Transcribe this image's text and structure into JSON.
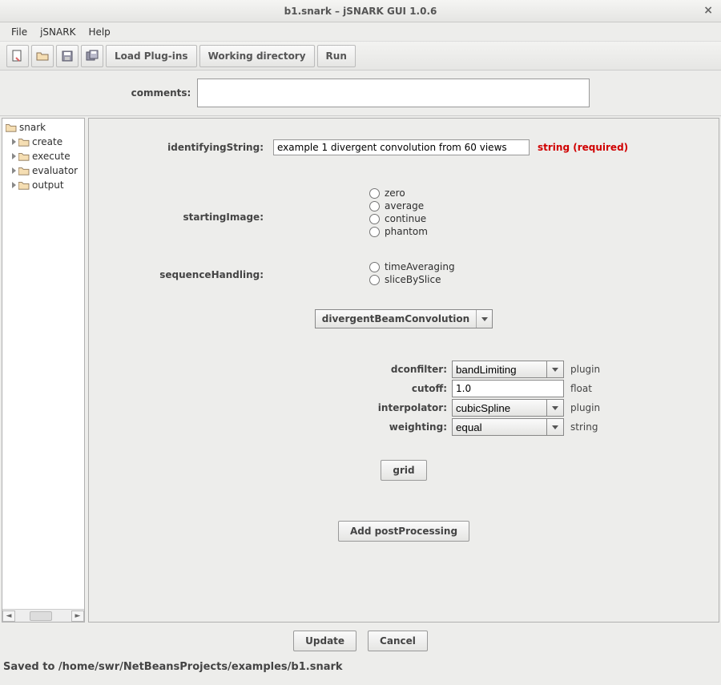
{
  "window": {
    "title": "b1.snark – jSNARK GUI 1.0.6"
  },
  "menubar": {
    "file": "File",
    "jsnark": "jSNARK",
    "help": "Help"
  },
  "toolbar": {
    "load_plugins": "Load Plug-ins",
    "working_directory": "Working directory",
    "run": "Run"
  },
  "comments": {
    "label": "comments:",
    "value": ""
  },
  "tree": {
    "root": "snark",
    "children": [
      "create",
      "execute",
      "evaluator",
      "output"
    ]
  },
  "form": {
    "identifyingString": {
      "label": "identifyingString:",
      "value": "example 1 divergent convolution from 60 views",
      "note": "string (required)"
    },
    "startingImage": {
      "label": "startingImage:",
      "options": [
        "zero",
        "average",
        "continue",
        "phantom"
      ],
      "selected": ""
    },
    "sequenceHandling": {
      "label": "sequenceHandling:",
      "options": [
        "timeAveraging",
        "sliceBySlice"
      ],
      "selected": ""
    },
    "algorithm": {
      "value": "divergentBeamConvolution"
    },
    "params": {
      "dconfilter": {
        "label": "dconfilter:",
        "value": "bandLimiting",
        "type": "plugin"
      },
      "cutoff": {
        "label": "cutoff:",
        "value": "1.0",
        "type": "float"
      },
      "interpolator": {
        "label": "interpolator:",
        "value": "cubicSpline",
        "type": "plugin"
      },
      "weighting": {
        "label": "weighting:",
        "value": "equal",
        "type": "string"
      }
    },
    "grid_button": "grid",
    "add_postprocessing": "Add postProcessing"
  },
  "buttons": {
    "update": "Update",
    "cancel": "Cancel"
  },
  "statusbar": "Saved to /home/swr/NetBeansProjects/examples/b1.snark"
}
